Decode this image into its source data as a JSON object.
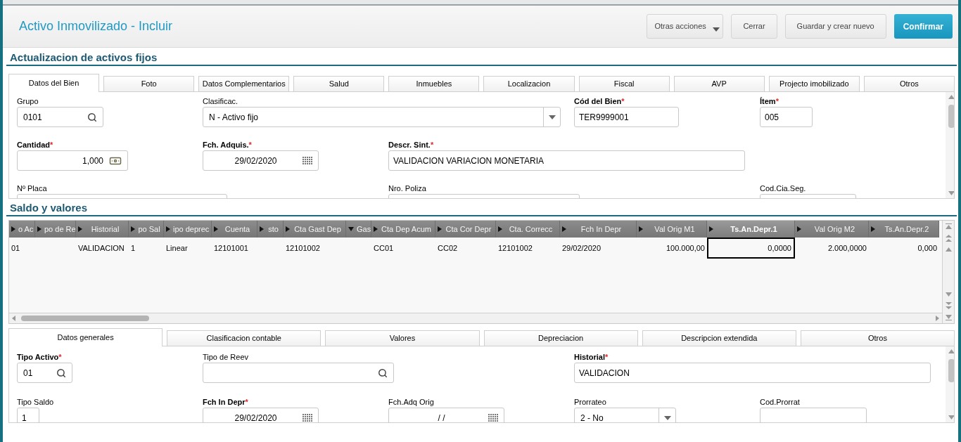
{
  "header": {
    "title": "Activo Inmovilizado - Incluir",
    "buttons": [
      {
        "label": "Otras acciones",
        "kind": "menu"
      },
      {
        "label": "Cerrar",
        "kind": "default"
      },
      {
        "label": "Guardar y crear nuevo",
        "kind": "default"
      },
      {
        "label": "Confirmar",
        "kind": "primary"
      }
    ]
  },
  "section_title": "Actualizacion de activos fijos",
  "tabs": [
    {
      "label": "Datos del Bien",
      "selected": true
    },
    {
      "label": "Foto",
      "selected": false
    },
    {
      "label": "Datos Complementarios",
      "selected": false
    },
    {
      "label": "Salud",
      "selected": false
    },
    {
      "label": "Inmuebles",
      "selected": false
    },
    {
      "label": "Localizacion",
      "selected": false
    },
    {
      "label": "Fiscal",
      "selected": false
    },
    {
      "label": "AVP",
      "selected": false
    },
    {
      "label": "Projecto imobilizado",
      "selected": false
    },
    {
      "label": "Otros",
      "selected": false
    }
  ],
  "fields": [
    {
      "label": "Grupo",
      "kind": "search",
      "value": "0101"
    },
    {
      "label": "Clasificac.",
      "kind": "select",
      "value": "N - Activo fijo"
    },
    {
      "label": "Cód del Bien",
      "asterisk": "*",
      "kind": "text",
      "value": "TER9999001"
    },
    {
      "label": "Ítem",
      "asterisk": "*",
      "kind": "text",
      "value": "005"
    },
    {
      "label": "Cantidad",
      "asterisk": "*",
      "kind": "number",
      "value": "1,000"
    },
    {
      "label": "Fch. Adquis.",
      "asterisk": "*",
      "kind": "date",
      "value": "29/02/2020"
    },
    {
      "label": "Descr. Sint.",
      "asterisk": "*",
      "kind": "text",
      "value": "VALIDACION VARIACION MONETARIA"
    },
    {
      "label": "Nº Placa",
      "kind": "text"
    },
    {
      "label": "Nro. Poliza",
      "kind": "text"
    },
    {
      "label": "Cod.Cia.Seg.",
      "kind": "text"
    }
  ],
  "grid_title": "Saldo y valores",
  "grid": {
    "columns": [
      {
        "label": "o Ac",
        "expanded": false,
        "selected": false
      },
      {
        "label": "po de Re",
        "expanded": false,
        "selected": false
      },
      {
        "label": "Historial",
        "expanded": false,
        "selected": false
      },
      {
        "label": "po Sal",
        "expanded": false,
        "selected": false
      },
      {
        "label": "ipo deprec",
        "expanded": false,
        "selected": false
      },
      {
        "label": "Cuenta",
        "expanded": false,
        "selected": false
      },
      {
        "label": "sto",
        "expanded": false,
        "selected": false
      },
      {
        "label": "Cta Gast Dep",
        "expanded": false,
        "selected": false
      },
      {
        "label": "Gas",
        "expanded": true,
        "selected": false
      },
      {
        "label": "Cta Dep Acum",
        "expanded": false,
        "selected": false
      },
      {
        "label": "Cta Cor Depr",
        "expanded": false,
        "selected": false
      },
      {
        "label": "Cta. Correcc",
        "expanded": false,
        "selected": false
      },
      {
        "label": "Fch In Depr",
        "expanded": false,
        "selected": false
      },
      {
        "label": "Val Orig M1",
        "expanded": false,
        "selected": false
      },
      {
        "label": "Ts.An.Depr.1",
        "expanded": false,
        "selected": true
      },
      {
        "label": "Val Orig M2",
        "expanded": false,
        "selected": false
      },
      {
        "label": "Ts.An.Depr.2",
        "expanded": false,
        "selected": false
      }
    ],
    "rows": [
      {
        "cells": [
          "01",
          null,
          "VALIDACION",
          "1",
          "Linear",
          "12101001",
          null,
          "12101002",
          null,
          "CC01",
          "CC02",
          "12101002",
          "29/02/2020",
          "100.000,00",
          "0,0000",
          "2.000,0000",
          "0,000"
        ]
      }
    ]
  },
  "bottom_tabs": [
    {
      "label": "Datos generales",
      "selected": true
    },
    {
      "label": "Clasificacion contable",
      "selected": false
    },
    {
      "label": "Valores",
      "selected": false
    },
    {
      "label": "Depreciacion",
      "selected": false
    },
    {
      "label": "Descripcion extendida",
      "selected": false
    },
    {
      "label": "Otros",
      "selected": false
    }
  ],
  "bottom_fields": [
    {
      "label": "Tipo Activo",
      "asterisk": "*",
      "kind": "search",
      "value": "01"
    },
    {
      "label": "Tipo de Reev",
      "kind": "search"
    },
    {
      "label": "Historial",
      "asterisk": "*",
      "kind": "text",
      "value": "VALIDACION"
    },
    {
      "label": "Tipo Saldo",
      "kind": "text",
      "value": "1"
    },
    {
      "label": "Fch In Depr",
      "asterisk": "*",
      "kind": "date",
      "value": "29/02/2020"
    },
    {
      "label": "Fch.Adq Orig",
      "kind": "date",
      "value": "/ /"
    },
    {
      "label": "Prorrateo",
      "kind": "select",
      "value": "2 - No"
    },
    {
      "label": "Cod.Prorrat",
      "kind": "text"
    }
  ]
}
